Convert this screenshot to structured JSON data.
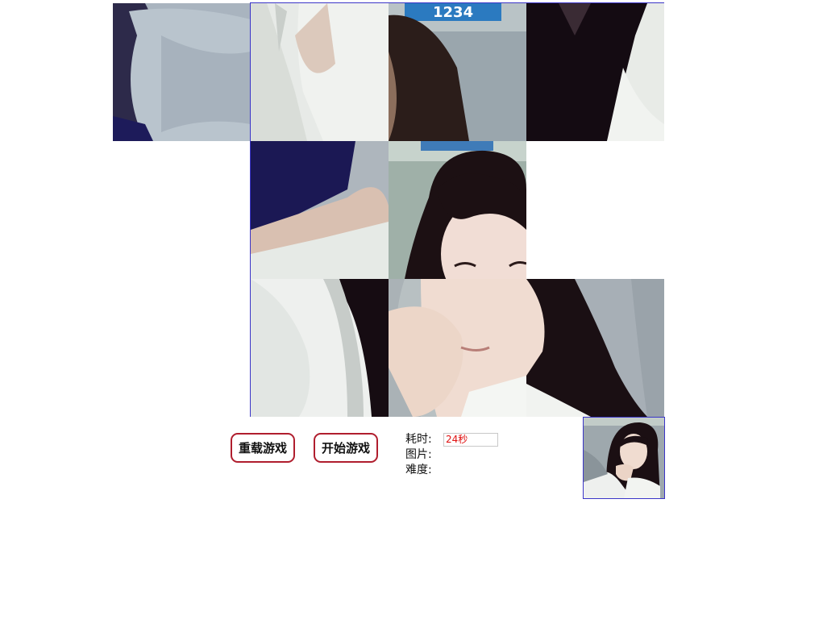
{
  "board": {
    "grid": "3x3",
    "tiles": [
      {
        "row": 0,
        "col": 0,
        "content": "shoulder-white-shirt"
      },
      {
        "row": 0,
        "col": 1,
        "content": "open-collar"
      },
      {
        "row": 0,
        "col": 2,
        "content": "hair-top-with-blue-sign"
      },
      {
        "row": 0,
        "col": 3,
        "content": "dark-hair-shoulder"
      },
      {
        "row": 1,
        "col": 1,
        "content": "arm-on-dark"
      },
      {
        "row": 1,
        "col": 2,
        "content": "face-top"
      },
      {
        "row": 1,
        "col": 3,
        "content": "empty-slot"
      },
      {
        "row": 2,
        "col": 1,
        "content": "white-sleeve"
      },
      {
        "row": 2,
        "col": 2,
        "content": "hand-on-chin"
      },
      {
        "row": 2,
        "col": 3,
        "content": "hair-bottom"
      }
    ]
  },
  "controls": {
    "reload_label": "重载游戏",
    "start_label": "开始游戏"
  },
  "info": {
    "time_label": "耗时:",
    "time_value": "24秒",
    "image_label": "图片:",
    "difficulty_label": "难度:"
  },
  "colors": {
    "board_border": "#3b35c8",
    "button_border": "#b01e2e",
    "timer_text": "#e01010"
  }
}
